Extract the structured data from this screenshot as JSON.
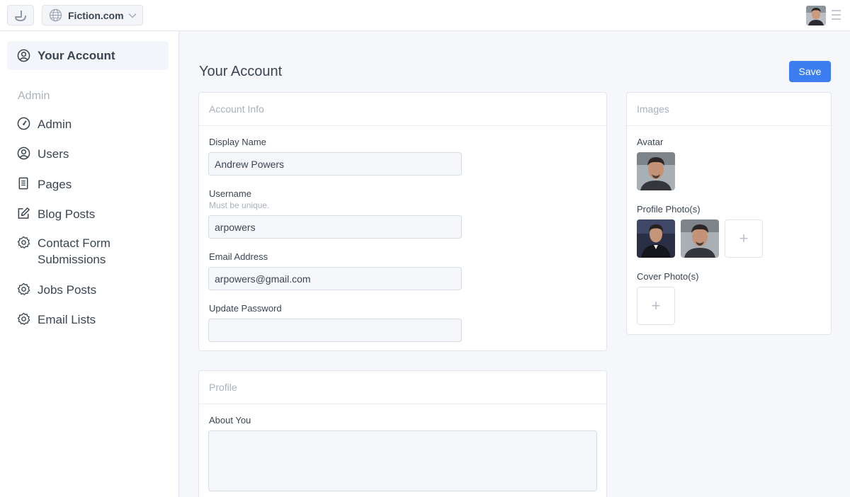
{
  "topbar": {
    "site_name": "Fiction.com",
    "logo_icon": "app-logo-icon",
    "globe_icon": "globe-icon",
    "menu_icon": "hamburger-menu-icon"
  },
  "sidebar": {
    "account_label": "Your Account",
    "admin_heading": "Admin",
    "items": [
      {
        "label": "Admin",
        "icon": "gauge-icon"
      },
      {
        "label": "Users",
        "icon": "user-circle-icon"
      },
      {
        "label": "Pages",
        "icon": "document-icon"
      },
      {
        "label": "Blog Posts",
        "icon": "edit-icon"
      },
      {
        "label": "Contact Form Submissions",
        "icon": "gear-icon"
      },
      {
        "label": "Jobs Posts",
        "icon": "gear-icon"
      },
      {
        "label": "Email Lists",
        "icon": "gear-icon"
      }
    ]
  },
  "main": {
    "title": "Your Account",
    "save_label": "Save",
    "account_info": {
      "header": "Account Info",
      "display_name_label": "Display Name",
      "display_name_value": "Andrew Powers",
      "username_label": "Username",
      "username_hint": "Must be unique.",
      "username_value": "arpowers",
      "email_label": "Email Address",
      "email_value": "arpowers@gmail.com",
      "password_label": "Update Password",
      "password_value": ""
    },
    "profile": {
      "header": "Profile",
      "about_label": "About You",
      "about_value": ""
    },
    "images": {
      "header": "Images",
      "avatar_label": "Avatar",
      "profile_photos_label": "Profile Photo(s)",
      "cover_photos_label": "Cover Photo(s)",
      "add_symbol": "+"
    }
  },
  "colors": {
    "accent": "#3c7ef1",
    "text": "#3b4552",
    "muted": "#a9b1bc",
    "background": "#f5f7fa"
  }
}
